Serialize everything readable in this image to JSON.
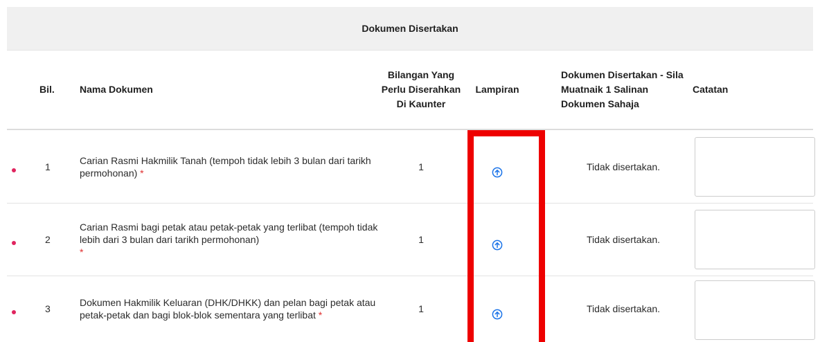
{
  "section": {
    "title": "Dokumen Disertakan"
  },
  "table": {
    "headers": {
      "bil": "Bil.",
      "nama": "Nama Dokumen",
      "bilangan": "Bilangan Yang Perlu Diserahkan Di Kaunter",
      "lampiran": "Lampiran",
      "dokumen": "Dokumen Disertakan - Sila Muatnaik 1 Salinan Dokumen Sahaja",
      "catatan": "Catatan"
    },
    "rows": [
      {
        "bil": "1",
        "nama": "Carian Rasmi Hakmilik Tanah (tempoh tidak lebih 3 bulan dari tarikh permohonan)",
        "required_mark": "*",
        "bilangan": "1",
        "status": "Tidak disertakan.",
        "catatan": ""
      },
      {
        "bil": "2",
        "nama": "Carian Rasmi bagi petak atau petak-petak yang terlibat (tempoh tidak lebih dari 3 bulan dari tarikh permohonan)",
        "required_mark": "*",
        "bilangan": "1",
        "status": "Tidak disertakan.",
        "catatan": ""
      },
      {
        "bil": "3",
        "nama": "Dokumen Hakmilik Keluaran (DHK/DHKK) dan pelan bagi petak atau petak-petak dan bagi blok-blok sementara yang terlibat",
        "required_mark": "*",
        "bilangan": "1",
        "status": "Tidak disertakan.",
        "catatan": ""
      }
    ]
  },
  "icons": {
    "upload": "upload-circle-arrow-icon",
    "required_bullet": "bullet-icon"
  },
  "colors": {
    "accent": "#1a73e8",
    "required": "#e03030",
    "bullet": "#e0245e",
    "highlight": "#ee0000",
    "header_bg": "#f0f0f0"
  }
}
